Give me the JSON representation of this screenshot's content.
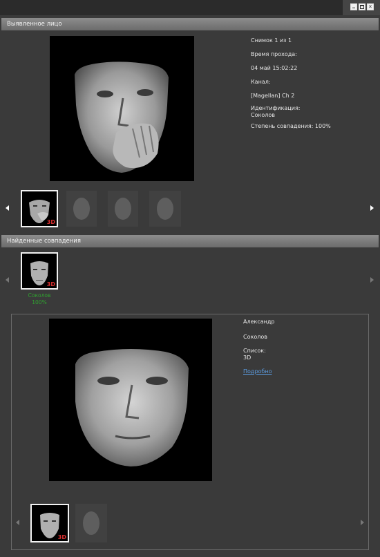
{
  "window": {
    "controls": [
      "minimize",
      "maximize",
      "close"
    ]
  },
  "detected": {
    "header": "Выявленное лицо",
    "info": {
      "snapshot": "Снимок 1 из 1",
      "pass_time_label": "Время прохода:",
      "pass_time_value": "04 май 15:02:22",
      "channel_label": "Канал:",
      "channel_value": "[Magellan] Ch 2",
      "identification_label": "Идентификация:",
      "identification_value": "Соколов",
      "match_degree": "Степень совпадения: 100%"
    },
    "thumbnails": [
      {
        "badge": "3D",
        "selected": true
      },
      {
        "badge": "",
        "selected": false
      },
      {
        "badge": "",
        "selected": false
      },
      {
        "badge": "",
        "selected": false
      }
    ]
  },
  "matches": {
    "header": "Найденные совпадения",
    "items": [
      {
        "name": "Соколов",
        "percent": "100%",
        "badge": "3D"
      }
    ],
    "detail": {
      "first_name": "Александр",
      "last_name": "Соколов",
      "list_label": "Список:",
      "list_value": "3D",
      "details_link": "Подробно"
    },
    "detail_thumbnails": [
      {
        "badge": "3D",
        "selected": true
      },
      {
        "badge": "",
        "selected": false
      }
    ]
  },
  "colors": {
    "background": "#3a3a3a",
    "header": "#7a7a7a",
    "match_text": "#2fa32f",
    "badge": "#e03030",
    "link": "#5b9be0"
  }
}
